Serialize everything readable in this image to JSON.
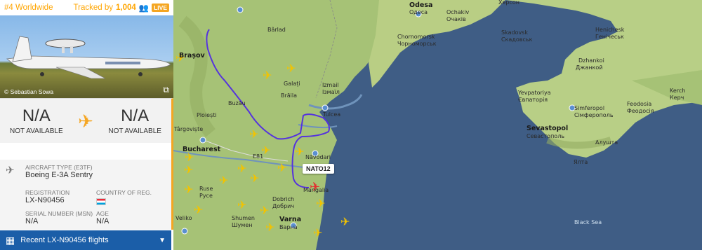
{
  "header": {
    "rank": "#4 Worldwide",
    "tracked_label": "Tracked by",
    "tracked_count": "1,004",
    "live": "LIVE"
  },
  "photo": {
    "credit": "© Sebastian Sowa"
  },
  "route": {
    "origin_code": "N/A",
    "origin_name": "NOT AVAILABLE",
    "dest_code": "N/A",
    "dest_name": "NOT AVAILABLE"
  },
  "details": {
    "aircraft_type_label": "AIRCRAFT TYPE (E3TF)",
    "aircraft_type": "Boeing E-3A Sentry",
    "registration_label": "REGISTRATION",
    "registration": "LX-N90456",
    "country_label": "COUNTRY OF REG.",
    "serial_label": "SERIAL NUMBER (MSN)",
    "serial": "N/A",
    "age_label": "AGE",
    "age": "N/A"
  },
  "recent_button": "Recent LX-N90456 flights",
  "callsign_tag": "NATO12",
  "map_labels": {
    "odesa": "Odesa",
    "odesa_uk": "Одеса",
    "ochakiv": "Ochakiv",
    "ochakiv_uk": "Очаків",
    "kherson": "Херсон",
    "chornomorsk": "Chornomorsk",
    "chornomorsk_uk": "Чорноморськ",
    "skadovsk": "Skadovsk",
    "skadovsk_uk": "Скадовськ",
    "henichesk": "Henichesk",
    "henichesk_uk": "Генічеськ",
    "dzhankoi": "Dzhankoi",
    "dzhankoi_uk": "Джанкой",
    "yevpatoriya": "Yevpatoriya",
    "yevpatoriya_uk": "Євпаторія",
    "simferopol": "Simferopol",
    "simferopol_uk": "Сімферополь",
    "kerch": "Kerch",
    "kerch_uk": "Керч",
    "feodosia": "Feodosia",
    "feodosia_uk": "Феодосія",
    "sevastopol": "Sevastopol",
    "sevastopol_uk": "Севастополь",
    "alushta": "Алушта",
    "yalta": "Ялта",
    "barlad": "Bârlad",
    "galati": "Galați",
    "braila": "Brăila",
    "izmail": "Izmail",
    "izmail_uk": "Ізмаїл",
    "tulcea": "Tulcea",
    "buzau": "Buzău",
    "ploiesti": "Ploiești",
    "brasov": "Brașov",
    "bucharest": "Bucharest",
    "targoviste": "Târgoviște",
    "ruse": "Ruse",
    "ruse_bg": "Русе",
    "dobrich": "Dobrich",
    "dobrich_bg": "Добрич",
    "shumen": "Shumen",
    "shumen_bg": "Шумен",
    "varna": "Varna",
    "varna_bg": "Варна",
    "mangalia": "Mangalia",
    "navodari": "Năvodari",
    "veliko": "Veliko",
    "black_sea": "Black Sea",
    "e81": "E81"
  },
  "colors": {
    "accent": "#f5a623",
    "track": "#5533dd",
    "button": "#1b5ea8",
    "sea": "#3d5a80",
    "land": "#9fbf6f"
  }
}
